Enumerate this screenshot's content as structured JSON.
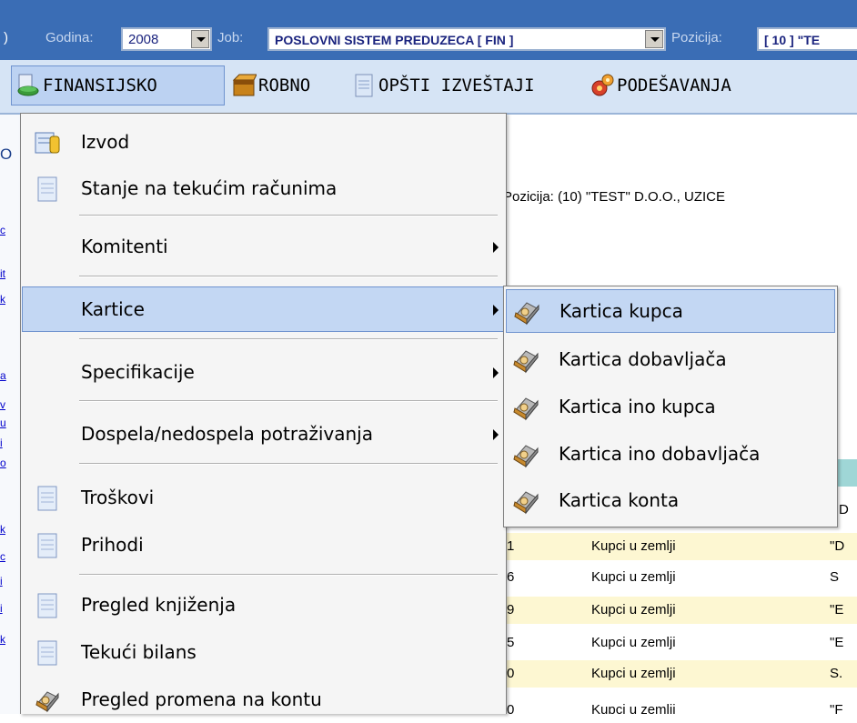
{
  "filter_bar": {
    "godina_label": "Godina:",
    "godina_value": "2008",
    "job_label": "Job:",
    "job_value": "POSLOVNI SISTEM PREDUZECA [ FIN ]",
    "pozicija_label": "Pozicija:",
    "pozicija_value": "[ 10 ] \"TE"
  },
  "menubar": {
    "items": [
      {
        "label": "FINANSIJSKO",
        "icon": "finance-icon"
      },
      {
        "label": "ROBNO",
        "icon": "box-icon"
      },
      {
        "label": "OPŠTI IZVEŠTAJI",
        "icon": "report-icon"
      },
      {
        "label": "PODEŠAVANJA",
        "icon": "gears-icon"
      }
    ]
  },
  "background": {
    "pozicija_text": "Pozicija: (10) \"TEST\" D.O.O., UZICE",
    "left_char": "O",
    "table_rows": [
      {
        "num": "1",
        "type": "Kupci u zemlji",
        "name": "\"D"
      },
      {
        "num": "6",
        "type": "Kupci u zemlji",
        "name": "S"
      },
      {
        "num": "9",
        "type": "Kupci u zemlji",
        "name": "\"E"
      },
      {
        "num": "5",
        "type": "Kupci u zemlji",
        "name": "\"E"
      },
      {
        "num": "0",
        "type": "Kupci u zemlji",
        "name": "S."
      },
      {
        "num": "0",
        "type": "Kupci u zemlji",
        "name": "\"F"
      }
    ],
    "header_partial": "D"
  },
  "dropdown": {
    "items": [
      {
        "label": "Izvod",
        "icon": "statement-icon"
      },
      {
        "label": "Stanje na tekućim računima",
        "icon": "document-icon"
      },
      {
        "label": "Komitenti"
      },
      {
        "label": "Kartice"
      },
      {
        "label": "Specifikacije"
      },
      {
        "label": "Dospela/nedospela potraživanja"
      },
      {
        "label": "Troškovi",
        "icon": "document-icon"
      },
      {
        "label": "Prihodi",
        "icon": "document-icon"
      },
      {
        "label": "Pregled knjiženja",
        "icon": "document-icon"
      },
      {
        "label": "Tekući bilans",
        "icon": "document-icon"
      },
      {
        "label": "Pregled promena na kontu",
        "icon": "card-icon"
      }
    ]
  },
  "submenu": {
    "items": [
      {
        "label": "Kartica kupca"
      },
      {
        "label": "Kartica dobavljača"
      },
      {
        "label": "Kartica ino kupca"
      },
      {
        "label": "Kartica ino dobavljača"
      },
      {
        "label": "Kartica konta"
      }
    ]
  },
  "colors": {
    "topbar": "#3a6db5",
    "menubar": "#d6e4f5",
    "highlight": "#c3d7f3",
    "highlight_border": "#6f93cf"
  }
}
